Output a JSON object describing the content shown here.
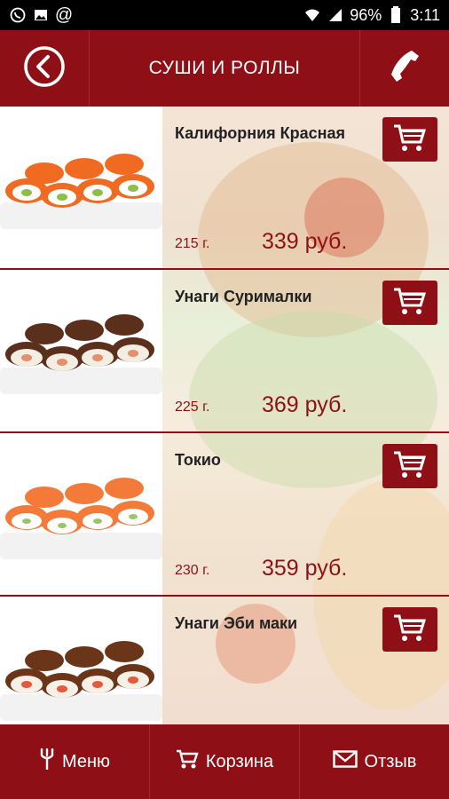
{
  "status_bar": {
    "battery": "96%",
    "time": "3:11",
    "icons": [
      "whatsapp-icon",
      "image-icon",
      "at-icon",
      "wifi-icon",
      "signal-icon",
      "battery-icon"
    ]
  },
  "header": {
    "title": "СУШИ И РОЛЛЫ",
    "back_icon": "back-icon",
    "phone_icon": "phone-icon"
  },
  "products": [
    {
      "name": "Калифорния Красная",
      "weight": "215 г.",
      "price": "339 руб.",
      "roe": "#f06a22"
    },
    {
      "name": "Унаги Сурималки",
      "weight": "225 г.",
      "price": "369 руб.",
      "roe": "#5a2f1c"
    },
    {
      "name": "Токио",
      "weight": "230 г.",
      "price": "359 руб.",
      "roe": "#f47a3a"
    },
    {
      "name": "Унаги Эби маки",
      "weight": "",
      "price": "",
      "roe": "#6a3518"
    }
  ],
  "bottom_nav": [
    {
      "label": "Меню",
      "icon": "fork-icon"
    },
    {
      "label": "Корзина",
      "icon": "cart-icon"
    },
    {
      "label": "Отзыв",
      "icon": "envelope-icon"
    }
  ],
  "colors": {
    "primary": "#8e1016",
    "text": "#222222"
  }
}
